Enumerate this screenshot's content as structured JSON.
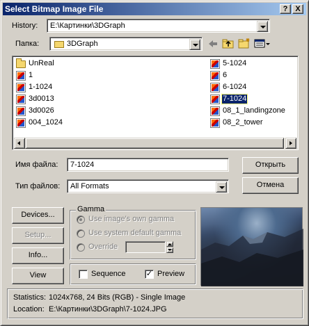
{
  "window": {
    "title": "Select Bitmap Image File"
  },
  "title_buttons": {
    "help": "?",
    "close": "X"
  },
  "history": {
    "label": "History:",
    "value": "E:\\Картинки\\3DGraph"
  },
  "folder": {
    "label": "Папка:",
    "value": "3DGraph"
  },
  "files": [
    {
      "name": "UnReal",
      "type": "folder"
    },
    {
      "name": "1",
      "type": "image"
    },
    {
      "name": "1-1024",
      "type": "image"
    },
    {
      "name": "3d0013",
      "type": "image"
    },
    {
      "name": "3d0026",
      "type": "image"
    },
    {
      "name": "004_1024",
      "type": "image"
    },
    {
      "name": "5-1024",
      "type": "image"
    },
    {
      "name": "6",
      "type": "image"
    },
    {
      "name": "6-1024",
      "type": "image"
    },
    {
      "name": "7-1024",
      "type": "image",
      "selected": true
    },
    {
      "name": "08_1_landingzone",
      "type": "image"
    },
    {
      "name": "08_2_tower",
      "type": "image"
    }
  ],
  "filename": {
    "label": "Имя файла:",
    "value": "7-1024"
  },
  "filetype": {
    "label": "Тип файлов:",
    "value": "All Formats"
  },
  "buttons": {
    "open": "Открыть",
    "cancel": "Отмена",
    "devices": "Devices...",
    "setup": "Setup...",
    "info": "Info...",
    "view": "View"
  },
  "gamma": {
    "title": "Gamma",
    "options": [
      "Use image's own gamma",
      "Use system default gamma",
      "Override"
    ],
    "selected_index": 0
  },
  "checks": {
    "sequence": "Sequence",
    "sequence_checked": false,
    "preview": "Preview",
    "preview_checked": true
  },
  "status": {
    "statistics_label": "Statistics:",
    "statistics_value": "1024x768, 24 Bits (RGB) - Single Image",
    "location_label": "Location:",
    "location_value": "E:\\Картинки\\3DGraph\\7-1024.JPG"
  }
}
